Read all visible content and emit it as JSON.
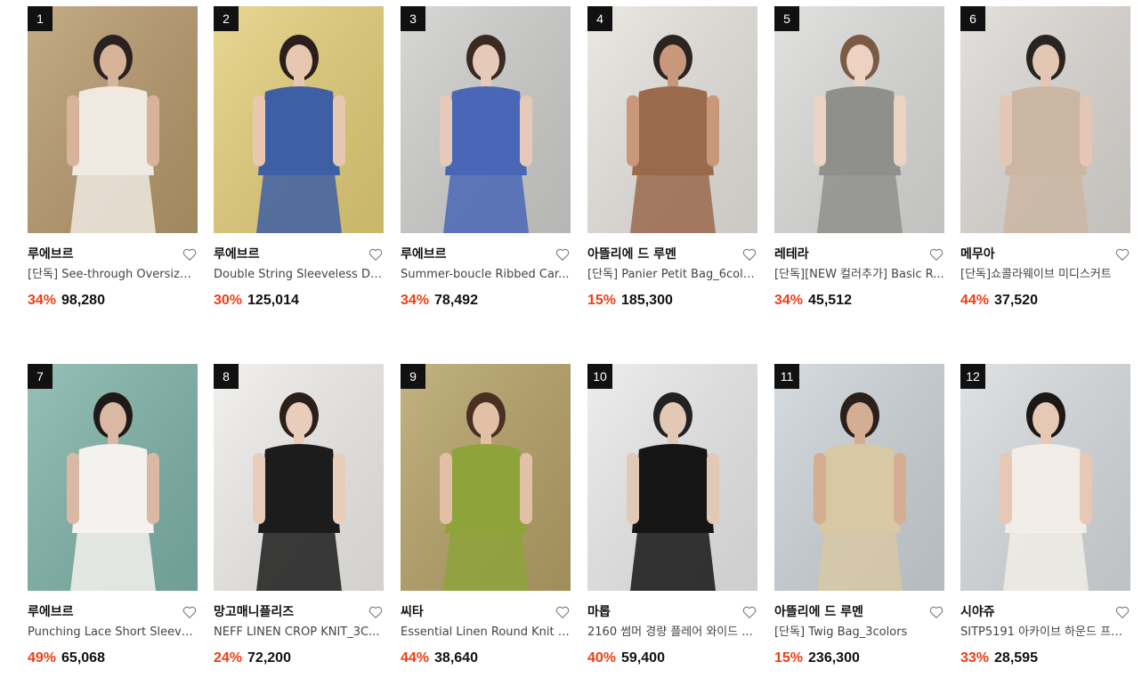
{
  "products": [
    {
      "rank": "1",
      "brand": "루에브르",
      "title": "[단독] See-through Oversize...",
      "discount": "34%",
      "price": "98,280",
      "bg": "#b79a6d",
      "accent": "#efe9e2",
      "skin": "#d7b39a",
      "hair": "#2a2220"
    },
    {
      "rank": "2",
      "brand": "루에브르",
      "title": "Double String Sleeveless Dr...",
      "discount": "30%",
      "price": "125,014",
      "bg": "#e4cf7a",
      "accent": "#3e5fa3",
      "skin": "#e7c7b0",
      "hair": "#2a1f1b"
    },
    {
      "rank": "3",
      "brand": "루에브르",
      "title": "Summer-boucle Ribbed Car...",
      "discount": "34%",
      "price": "78,492",
      "bg": "#cfcfcd",
      "accent": "#4967b6",
      "skin": "#e6c9b8",
      "hair": "#3a2a22"
    },
    {
      "rank": "4",
      "brand": "아뜰리에 드 루멘",
      "title": "[단독] Panier Petit Bag_6colors",
      "discount": "15%",
      "price": "185,300",
      "bg": "#e7e4df",
      "accent": "#9a6a4d",
      "skin": "#c9987a",
      "hair": "#2b2420"
    },
    {
      "rank": "5",
      "brand": "레테라",
      "title": "[단독][NEW 컬러추가] Basic R...",
      "discount": "34%",
      "price": "45,512",
      "bg": "#dcdcda",
      "accent": "#8f8f8c",
      "skin": "#ecd2c2",
      "hair": "#7a5a44"
    },
    {
      "rank": "6",
      "brand": "메무아",
      "title": "[단독]쇼콜라웨이브 미디스커트",
      "discount": "44%",
      "price": "37,520",
      "bg": "#dedad6",
      "accent": "#cbb6a3",
      "skin": "#e3c7b4",
      "hair": "#2a2421"
    },
    {
      "rank": "7",
      "brand": "루에브르",
      "title": "Punching Lace Short Sleeve ...",
      "discount": "49%",
      "price": "65,068",
      "bg": "#7fb3a8",
      "accent": "#f4f2ee",
      "skin": "#d9b8a4",
      "hair": "#1f1a18"
    },
    {
      "rank": "8",
      "brand": "망고매니플리즈",
      "title": "NEFF LINEN CROP KNIT_3C...",
      "discount": "24%",
      "price": "72,200",
      "bg": "#f0eeeb",
      "accent": "#1c1c1c",
      "skin": "#e8cdbb",
      "hair": "#2a1f1b"
    },
    {
      "rank": "9",
      "brand": "씨타",
      "title": "Essential Linen Round Knit C...",
      "discount": "44%",
      "price": "38,640",
      "bg": "#b6a267",
      "accent": "#8ea33a",
      "skin": "#e2c0a6",
      "hair": "#4a3023"
    },
    {
      "rank": "10",
      "brand": "마롭",
      "title": "2160 썸머 경량 플레어 와이드 ...",
      "discount": "40%",
      "price": "59,400",
      "bg": "#eaeaea",
      "accent": "#151515",
      "skin": "#e4c8b6",
      "hair": "#222"
    },
    {
      "rank": "11",
      "brand": "아뜰리에 드 루멘",
      "title": "[단독] Twig Bag_3colors",
      "discount": "15%",
      "price": "236,300",
      "bg": "#cdd4d8",
      "accent": "#d8c8a4",
      "skin": "#d4ad93",
      "hair": "#2a1f1b"
    },
    {
      "rank": "12",
      "brand": "시야쥬",
      "title": "SITP5191 아카이브 하운드 프린...",
      "discount": "33%",
      "price": "28,595",
      "bg": "#d9dcdf",
      "accent": "#f1ede6",
      "skin": "#e6c8b5",
      "hair": "#1c1816"
    }
  ],
  "colors": {
    "discount": "#ee3e12",
    "rank_bg": "#111111",
    "heart_stroke": "#777777"
  },
  "icons": {
    "wishlist": "heart-outline-icon"
  }
}
